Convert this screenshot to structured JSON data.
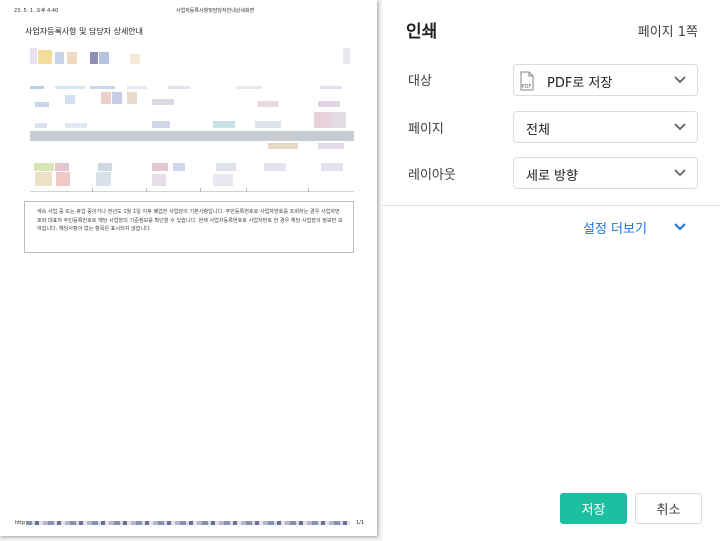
{
  "preview": {
    "header_date": "23. 5. 1. 오후 4:40",
    "header_title": "사업자등록사항및담당자안내상세화면",
    "doc_title": "사업자등록사항 및 담당자 상세안내",
    "notice_text": "계속 사업 중 또는 휴업 중이거나 전년도 1월 1일 이후 폐업한 사업장의 기본사항입니다. 주민등록번호로 사업자번호를 조회하는 경우 사업자번호와 대표자 주민등록번호로 해당 사업장의 기준정보를 확인할 수 있습니다. 현재 사업자등록번호로 사업자번호 한 경우 해당 사업장의 정보만 보여집니다. 해당사항이 없는 항목은 표시되지 않습니다.",
    "footer_url": "http",
    "page_number": "1/1"
  },
  "dialog": {
    "title": "인쇄",
    "page_count": "페이지 1쪽",
    "destination_label": "대상",
    "destination_value": "PDF로 저장",
    "pages_label": "페이지",
    "pages_value": "전체",
    "layout_label": "레이아웃",
    "layout_value": "세로 방향",
    "more_settings": "설정 더보기",
    "save_button": "저장",
    "cancel_button": "취소"
  },
  "colors": {
    "accent_button": "#1cc0a0",
    "link": "#1a73e8"
  },
  "icons": {
    "pdf": "pdf-file-icon",
    "dropdown": "chevron-down-icon"
  }
}
